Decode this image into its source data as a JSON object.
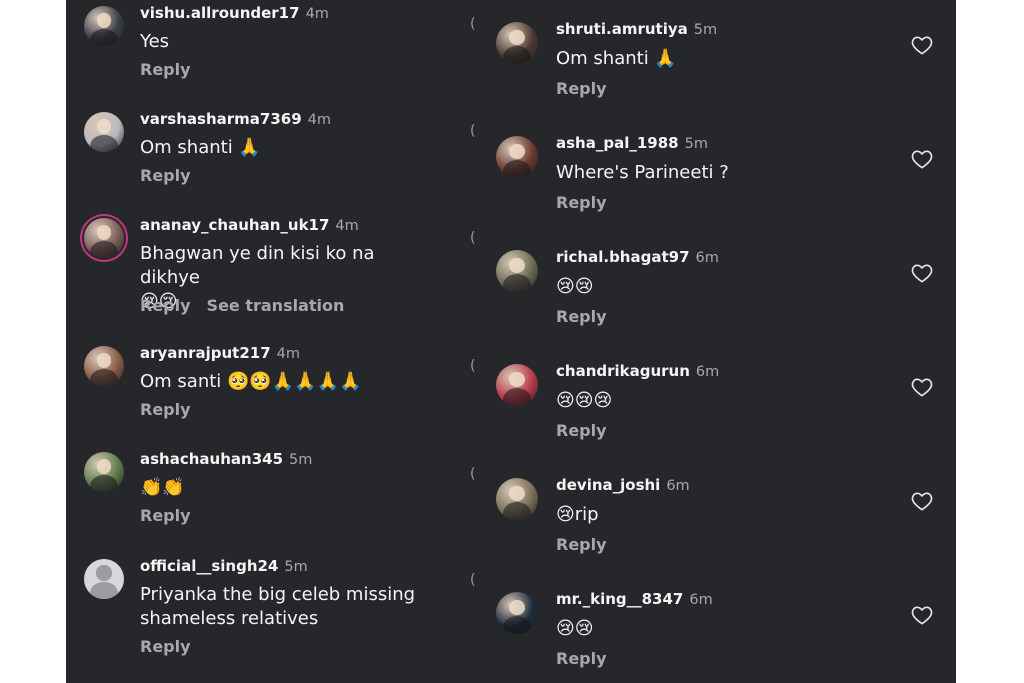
{
  "left_comments": [
    {
      "username": "vishu.allrounder17",
      "time": "4m",
      "text": "Yes",
      "reply": "Reply",
      "avatar": "#3a3f48"
    },
    {
      "username": "varshasharma7369",
      "time": "4m",
      "text": "Om shanti 🙏",
      "reply": "Reply",
      "avatar": "#b9b8bc"
    },
    {
      "username": "ananay_chauhan_uk17",
      "time": "4m",
      "text": "Bhagwan ye din kisi ko na dikhye\n😢😢",
      "reply": "Reply",
      "extra": "See translation",
      "avatar": "#7b5d57"
    },
    {
      "username": "aryanrajput217",
      "time": "4m",
      "text": "Om santi 🥺🥺🙏🙏🙏🙏",
      "reply": "Reply",
      "avatar": "#8a5b47"
    },
    {
      "username": "ashachauhan345",
      "time": "5m",
      "text": "👏👏",
      "reply": "Reply",
      "avatar": "#5d7b4a"
    },
    {
      "username": "official__singh24",
      "time": "5m",
      "text": "Priyanka the big celeb missing\nshameless relatives",
      "reply": "Reply",
      "avatar": "default"
    }
  ],
  "right_comments": [
    {
      "username": "shruti.amrutiya",
      "time": "5m",
      "text": "Om shanti 🙏",
      "reply": "Reply",
      "avatar": "#4c3a33"
    },
    {
      "username": "asha_pal_1988",
      "time": "5m",
      "text": "Where's Parineeti ?",
      "reply": "Reply",
      "avatar": "#6b3a2e"
    },
    {
      "username": "richal.bhagat97",
      "time": "6m",
      "text": "😢😢",
      "reply": "Reply",
      "avatar": "#6d6a55"
    },
    {
      "username": "chandrikagurun",
      "time": "6m",
      "text": "😢😢😢",
      "reply": "Reply",
      "avatar": "#b83a4a"
    },
    {
      "username": "devina_joshi",
      "time": "6m",
      "text": "😢rip",
      "reply": "Reply",
      "avatar": "#7a6f58"
    },
    {
      "username": "mr._king__8347",
      "time": "6m",
      "text": "😢😢",
      "reply": "Reply",
      "avatar": "#1d2c3c"
    }
  ],
  "colors": {
    "background": "#26272b",
    "primary_text": "#f5f5f5",
    "secondary_text": "#a7a8ad",
    "story_ring": "#c13584"
  },
  "icons": {
    "like": "heart-outline-icon",
    "avatar_default": "default-profile-icon"
  }
}
